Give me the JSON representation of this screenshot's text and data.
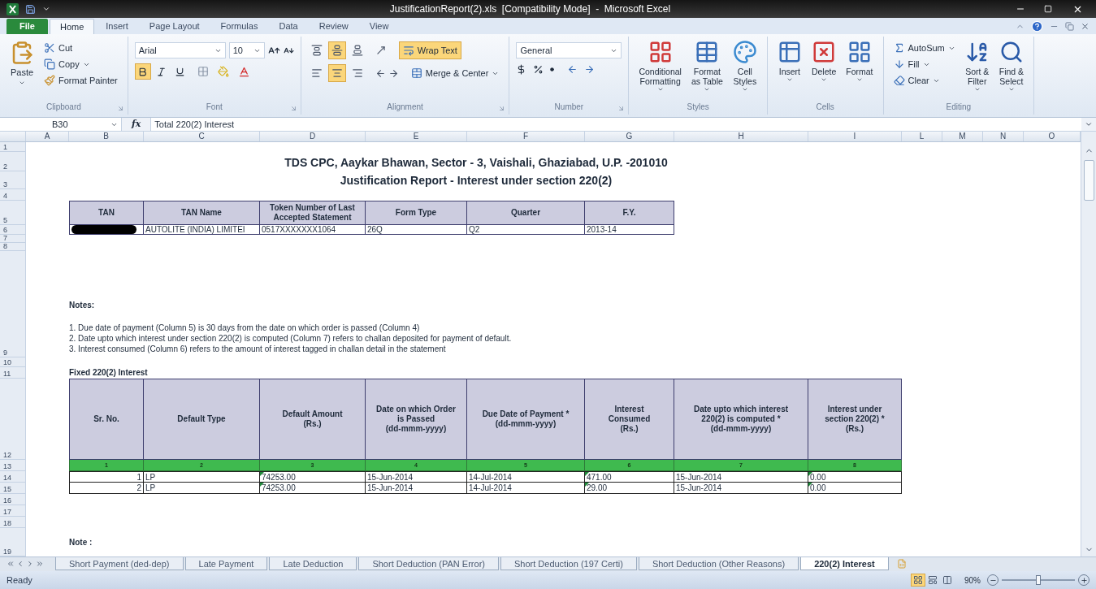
{
  "window": {
    "title": "JustificationReport(2).xls  [Compatibility Mode]  -  Microsoft Excel"
  },
  "file_tab": "File",
  "ribbon_tabs": [
    {
      "label": "Home",
      "selected": true
    },
    {
      "label": "Insert",
      "selected": false
    },
    {
      "label": "Page Layout",
      "selected": false
    },
    {
      "label": "Formulas",
      "selected": false
    },
    {
      "label": "Data",
      "selected": false
    },
    {
      "label": "Review",
      "selected": false
    },
    {
      "label": "View",
      "selected": false
    }
  ],
  "ribbon_groups": [
    {
      "kind": "clipboard",
      "label": "Clipboard",
      "paste": "Paste",
      "cut": "Cut",
      "copy": "Copy",
      "format_painter": "Format Painter"
    },
    {
      "kind": "font",
      "label": "Font",
      "font_name": "Arial",
      "font_size": "10",
      "toggles": [
        {
          "kind": "bold",
          "selected": true
        },
        {
          "kind": "italic",
          "selected": false
        },
        {
          "kind": "underline",
          "selected": false
        }
      ]
    },
    {
      "kind": "alignment",
      "label": "Alignment",
      "vertical": [
        {
          "kind": "top",
          "selected": false
        },
        {
          "kind": "middle",
          "selected": true
        },
        {
          "kind": "bottom",
          "selected": false
        }
      ],
      "horizontal": [
        {
          "kind": "left",
          "selected": false
        },
        {
          "kind": "center",
          "selected": true
        },
        {
          "kind": "right",
          "selected": false
        }
      ],
      "wrap_text": {
        "label": "Wrap Text",
        "selected": true
      },
      "merge": "Merge & Center"
    },
    {
      "kind": "number",
      "label": "Number",
      "format": "General"
    },
    {
      "kind": "styles",
      "label": "Styles",
      "buttons": [
        {
          "kind": "conditional",
          "label": "Conditional\nFormatting"
        },
        {
          "kind": "table",
          "label": "Format\nas Table"
        },
        {
          "kind": "cell_styles",
          "label": "Cell\nStyles"
        }
      ]
    },
    {
      "kind": "cells",
      "label": "Cells",
      "buttons": [
        {
          "kind": "insert",
          "label": "Insert"
        },
        {
          "kind": "delete",
          "label": "Delete"
        },
        {
          "kind": "format",
          "label": "Format"
        }
      ]
    },
    {
      "kind": "editing",
      "label": "Editing",
      "small": [
        {
          "kind": "autosum",
          "label": "AutoSum"
        },
        {
          "kind": "fill",
          "label": "Fill"
        },
        {
          "kind": "clear",
          "label": "Clear"
        }
      ],
      "big": [
        {
          "kind": "sort",
          "label": "Sort &\nFilter"
        },
        {
          "kind": "find",
          "label": "Find &\nSelect"
        }
      ]
    }
  ],
  "formula_bar": {
    "name_box": "B30",
    "function_label": "fx",
    "formula": "Total 220(2) Interest"
  },
  "columns": [
    "A",
    "B",
    "C",
    "D",
    "E",
    "F",
    "G",
    "H",
    "I",
    "L",
    "M",
    "N",
    "O"
  ],
  "rows": [
    "1",
    "2",
    "3",
    "4",
    "5",
    "6",
    "7",
    "8",
    "9",
    "10",
    "11",
    "12",
    "13",
    "14",
    "15",
    "16",
    "17",
    "18",
    "19"
  ],
  "report_titles": [
    "TDS CPC, Aaykar Bhawan, Sector - 3, Vaishali, Ghaziabad, U.P. -201010",
    "Justification Report - Interest under section 220(2)"
  ],
  "summary_table": {
    "columns": [
      "TAN",
      "TAN Name",
      "Token Number of Last Accepted Statement",
      "Form Type",
      "Quarter",
      "F.Y."
    ],
    "row": [
      {
        "redacted": true
      },
      {
        "text": "AUTOLITE (INDIA) LIMITEI",
        "redacted": false
      },
      {
        "text": "0517XXXXXXX1064",
        "redacted": false
      },
      {
        "text": "26Q",
        "redacted": false
      },
      {
        "text": "Q2",
        "redacted": false
      },
      {
        "text": "2013-14",
        "redacted": false
      }
    ]
  },
  "notes_heading": "Notes:",
  "notes": [
    "1. Due date of payment (Column 5) is 30 days from the date on which order is passed (Column 4)",
    "2. Date upto which interest under section 220(2) is computed (Column 7) refers to challan deposited for payment of default.",
    "3. Interest consumed (Column 6) refers to the amount of interest tagged in challan detail in the statement"
  ],
  "interest_section": {
    "title": "Fixed 220(2) Interest",
    "columns": [
      "Sr. No.",
      "Default Type",
      "Default Amount\n(Rs.)",
      "Date on which Order\nis Passed\n(dd-mmm-yyyy)",
      "Due Date of Payment *\n(dd-mmm-yyyy)",
      "Interest\nConsumed\n(Rs.)",
      "Date upto which interest\n220(2) is computed *\n(dd-mmm-yyyy)",
      "Interest under\nsection 220(2) *\n(Rs.)"
    ],
    "column_numbers": [
      "1",
      "2",
      "3",
      "4",
      "5",
      "6",
      "7",
      "8"
    ],
    "rows": [
      [
        {
          "text": "1",
          "flagged": false
        },
        {
          "text": "LP",
          "flagged": false
        },
        {
          "text": "74253.00",
          "flagged": true
        },
        {
          "text": "15-Jun-2014",
          "flagged": false
        },
        {
          "text": "14-Jul-2014",
          "flagged": false
        },
        {
          "text": "471.00",
          "flagged": true
        },
        {
          "text": "15-Jun-2014",
          "flagged": false
        },
        {
          "text": "0.00",
          "flagged": true
        }
      ],
      [
        {
          "text": "2",
          "flagged": false
        },
        {
          "text": "LP",
          "flagged": false
        },
        {
          "text": "74253.00",
          "flagged": true
        },
        {
          "text": "15-Jun-2014",
          "flagged": false
        },
        {
          "text": "14-Jul-2014",
          "flagged": false
        },
        {
          "text": "29.00",
          "flagged": true
        },
        {
          "text": "15-Jun-2014",
          "flagged": false
        },
        {
          "text": "0.00",
          "flagged": true
        }
      ]
    ]
  },
  "footer_note": "Note :",
  "sheet_tabs": [
    {
      "label": "Short Payment (ded-dep)",
      "selected": false
    },
    {
      "label": "Late Payment",
      "selected": false
    },
    {
      "label": "Late Deduction",
      "selected": false
    },
    {
      "label": "Short Deduction (PAN Error)",
      "selected": false
    },
    {
      "label": "Short Deduction (197 Certi)",
      "selected": false
    },
    {
      "label": "Short Deduction (Other Reasons)",
      "selected": false
    },
    {
      "label": "220(2) Interest",
      "selected": true
    }
  ],
  "status_bar": {
    "status": "Ready",
    "views": [
      {
        "kind": "normal",
        "selected": true
      },
      {
        "kind": "page_layout",
        "selected": false
      },
      {
        "kind": "page_break",
        "selected": false
      }
    ],
    "zoom": "90%",
    "zoom_level": {
      "level": 0.5
    }
  }
}
